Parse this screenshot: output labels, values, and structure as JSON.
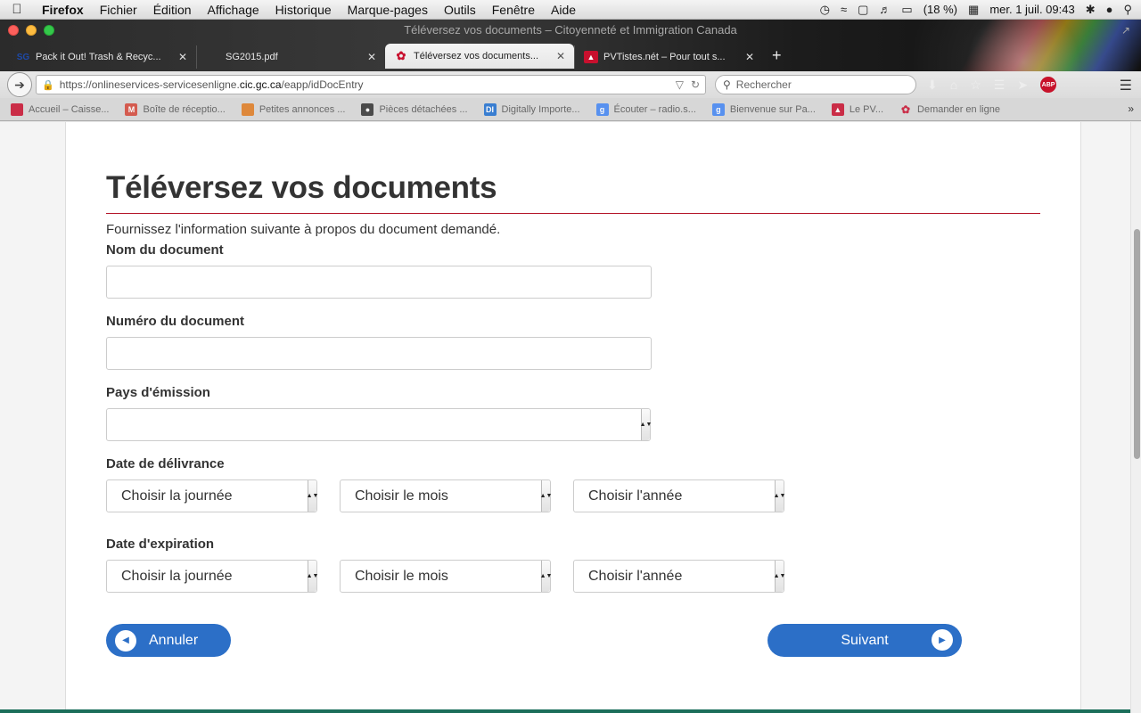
{
  "menubar": {
    "apple": "",
    "items": [
      "Firefox",
      "Fichier",
      "Édition",
      "Affichage",
      "Historique",
      "Marque-pages",
      "Outils",
      "Fenêtre",
      "Aide"
    ],
    "battery": "(18 %)",
    "clock": "mer. 1 juil.  09:43"
  },
  "window": {
    "title": "Téléversez vos documents – Citoyenneté et Immigration Canada"
  },
  "tabs": [
    {
      "favicon": "SG",
      "label": "Pack it Out! Trash & Recyc...",
      "active": false
    },
    {
      "favicon": "",
      "label": "SG2015.pdf",
      "active": false
    },
    {
      "favicon": "maple-leaf",
      "label": "Téléversez vos documents...",
      "active": true
    },
    {
      "favicon": "pdf",
      "label": "PVTistes.nét – Pour tout s...",
      "active": false
    }
  ],
  "newtab": "+",
  "navbar": {
    "url_prefix": "https://onlineservices-servicesenligne.",
    "url_domain": "cic.gc.ca",
    "url_suffix": "/eapp/idDocEntry",
    "search_placeholder": "Rechercher",
    "abp": "ABP"
  },
  "bookmarks": [
    {
      "label": "Accueil – Caisse...",
      "color": "#c8102e"
    },
    {
      "label": "Boîte de réceptio...",
      "color": "#d44638"
    },
    {
      "label": "Petites annonces ...",
      "color": "#e07b20"
    },
    {
      "label": "Pièces détachées ...",
      "color": "#333333"
    },
    {
      "label": "Digitally Importe...",
      "color": "#1e6fd0"
    },
    {
      "label": "Écouter – radio.s...",
      "color": "#4285f4"
    },
    {
      "label": "Bienvenue sur Pa...",
      "color": "#4285f4"
    },
    {
      "label": "Le PV...",
      "color": "#c8102e"
    },
    {
      "label": "Demander en ligne",
      "color": "#c8102e"
    }
  ],
  "page": {
    "heading": "Téléversez vos documents",
    "intro": "Fournissez l'information suivante à propos du document demandé.",
    "fields": {
      "doc_name_label": "Nom du document",
      "doc_number_label": "Numéro du document",
      "country_label": "Pays d'émission",
      "issue_date_label": "Date de délivrance",
      "expiry_date_label": "Date d'expiration"
    },
    "selects": {
      "day": "Choisir la journée",
      "month": "Choisir le mois",
      "year": "Choisir l'année"
    },
    "buttons": {
      "cancel": "Annuler",
      "next": "Suivant"
    }
  },
  "colors": {
    "accent_red": "#b5172b",
    "button_blue": "#2c6fc7"
  }
}
